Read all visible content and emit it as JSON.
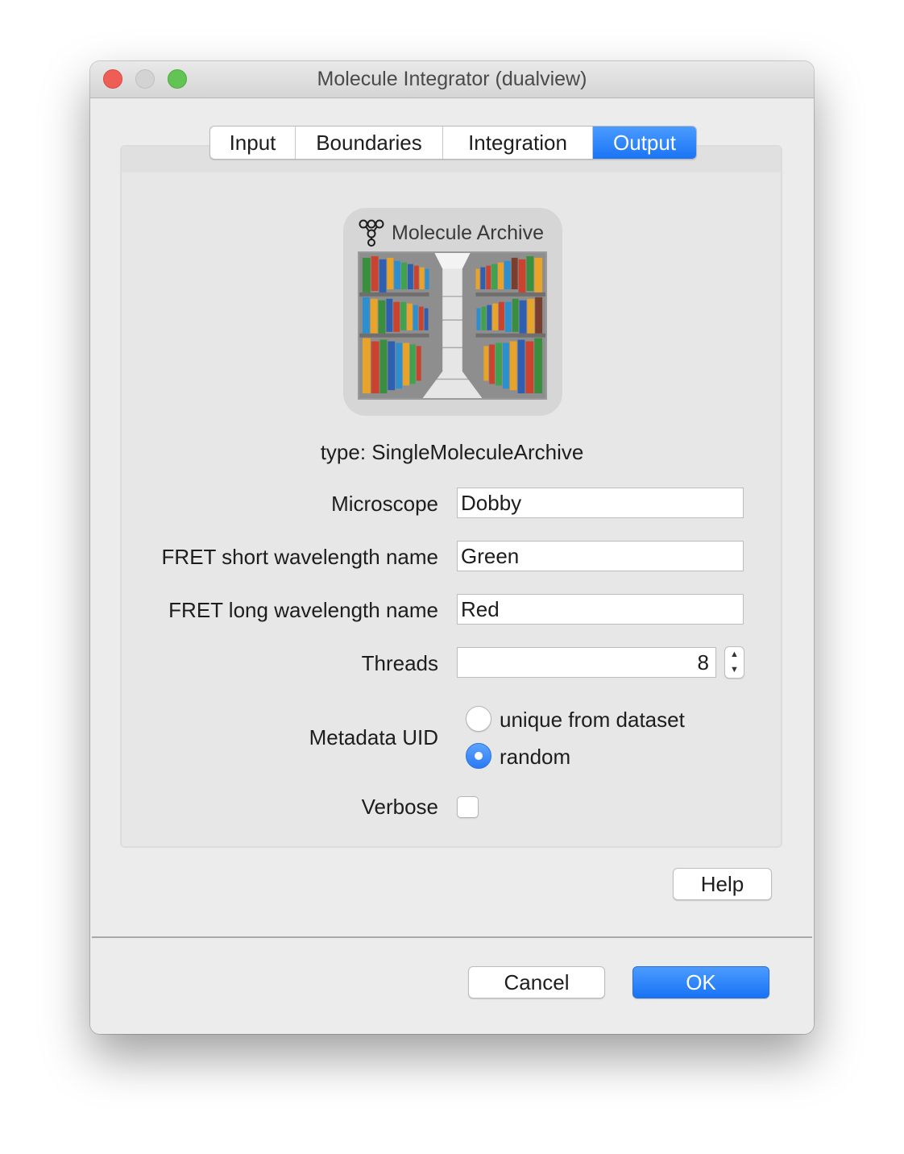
{
  "window": {
    "title": "Molecule Integrator (dualview)"
  },
  "tabs": [
    {
      "label": "Input",
      "active": false
    },
    {
      "label": "Boundaries",
      "active": false
    },
    {
      "label": "Integration",
      "active": false
    },
    {
      "label": "Output",
      "active": true
    }
  ],
  "archive": {
    "header": "Molecule Archive",
    "icon": "molecule-icon",
    "image": "archive-bookshelf-illustration",
    "type_line": "type: SingleMoleculeArchive"
  },
  "form": {
    "microscope": {
      "label": "Microscope",
      "value": "Dobby"
    },
    "fret_short": {
      "label": "FRET short wavelength name",
      "value": "Green"
    },
    "fret_long": {
      "label": "FRET long wavelength name",
      "value": "Red"
    },
    "threads": {
      "label": "Threads",
      "value": "8"
    },
    "metadata_uid": {
      "label": "Metadata UID",
      "options": [
        {
          "label": "unique from dataset",
          "selected": false
        },
        {
          "label": "random",
          "selected": true
        }
      ]
    },
    "verbose": {
      "label": "Verbose",
      "checked": false
    }
  },
  "buttons": {
    "help": "Help",
    "cancel": "Cancel",
    "ok": "OK"
  },
  "colors": {
    "accent": "#1a74f5",
    "close": "#ee5e57",
    "maximize": "#61c454"
  }
}
